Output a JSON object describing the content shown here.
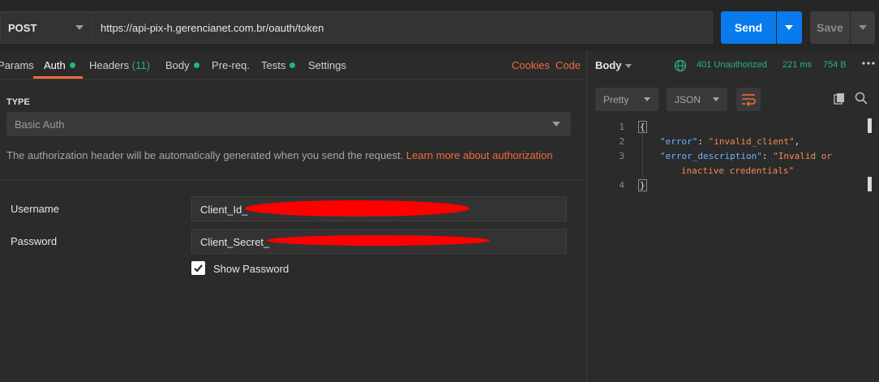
{
  "request": {
    "method": "POST",
    "url": "https://api-pix-h.gerencianet.com.br/oauth/token",
    "send_label": "Send",
    "save_label": "Save"
  },
  "tabs": [
    {
      "label": "Params",
      "dot": false
    },
    {
      "label": "Auth",
      "dot": true,
      "active": true
    },
    {
      "label": "Headers",
      "count": "(11)"
    },
    {
      "label": "Body",
      "dot": true
    },
    {
      "label": "Pre-req.",
      "dot": false
    },
    {
      "label": "Tests",
      "dot": true
    },
    {
      "label": "Settings",
      "dot": false
    }
  ],
  "links": {
    "cookies": "Cookies",
    "code": "Code"
  },
  "auth": {
    "type_label": "TYPE",
    "type_value": "Basic Auth",
    "description": "The authorization header will be automatically generated when you send the request.",
    "learn_more": "Learn more about authorization",
    "username_label": "Username",
    "username_value": "Client_Id_",
    "password_label": "Password",
    "password_value": "Client_Secret_",
    "show_password_label": "Show Password",
    "show_password_checked": true
  },
  "response": {
    "body_label": "Body",
    "status": "401 Unauthorized",
    "time": "221 ms",
    "size": "754 B",
    "format_label": "Pretty",
    "language_label": "JSON",
    "line_numbers": [
      "1",
      "2",
      "3",
      "4"
    ],
    "lines": {
      "open": "{",
      "error_key": "\"error\"",
      "error_value": "\"invalid_client\"",
      "desc_key": "\"error_description\"",
      "desc_value_1": "\"Invalid or",
      "desc_value_2": "inactive credentials\"",
      "close": "}"
    }
  },
  "colors": {
    "accent": "#f26b3a",
    "send_blue": "#097bed",
    "status_green": "#26b47f",
    "json_key": "#6fb3ff",
    "json_string": "#f28b54",
    "redaction": "#ff0000"
  }
}
